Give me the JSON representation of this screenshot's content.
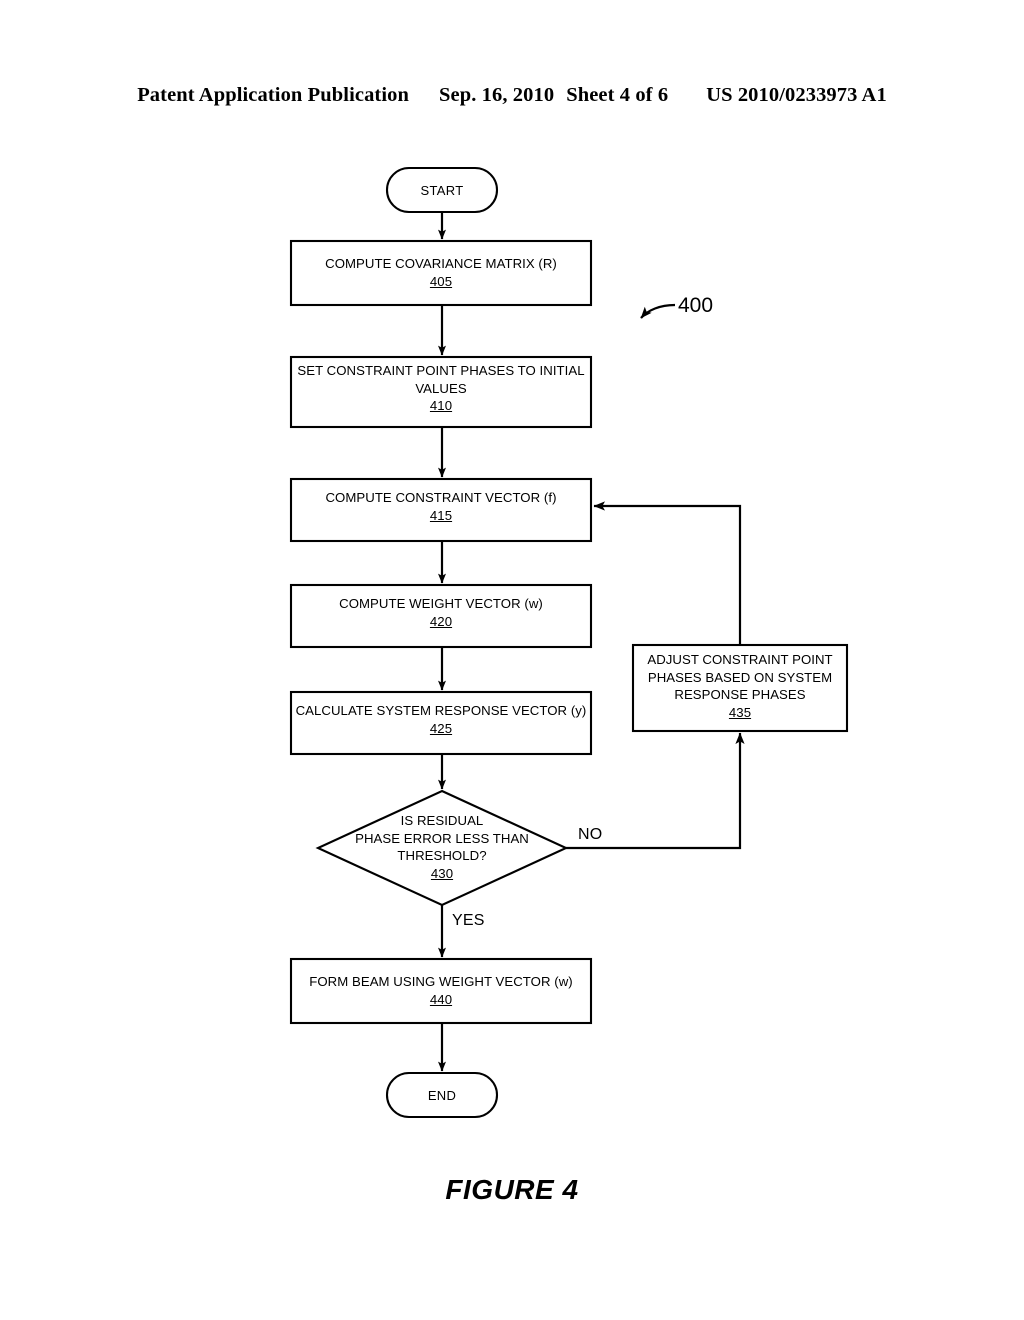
{
  "header": {
    "publication": "Patent Application Publication",
    "date": "Sep. 16, 2010",
    "sheet": "Sheet 4 of 6",
    "patent_number": "US 2010/0233973 A1"
  },
  "caption": "FIGURE 4",
  "diagram": {
    "reference_numeral": "400",
    "stroke_color": "#000000",
    "fill_color": "#ffffff",
    "nodes": {
      "start": {
        "label": "START",
        "shape": "terminal"
      },
      "step_405": {
        "line1": "COMPUTE COVARIANCE MATRIX (R)",
        "ref": "405",
        "shape": "process"
      },
      "step_410": {
        "line1": "SET CONSTRAINT POINT PHASES TO INITIAL",
        "line2": "VALUES",
        "ref": "410",
        "shape": "process"
      },
      "step_415": {
        "line1": "COMPUTE CONSTRAINT VECTOR (f)",
        "ref": "415",
        "shape": "process"
      },
      "step_420": {
        "line1": "COMPUTE WEIGHT VECTOR (w)",
        "ref": "420",
        "shape": "process"
      },
      "step_425": {
        "line1": "CALCULATE SYSTEM RESPONSE VECTOR (y)",
        "ref": "425",
        "shape": "process"
      },
      "decision_430": {
        "line1": "IS RESIDUAL",
        "line2": "PHASE ERROR LESS THAN",
        "line3": "THRESHOLD?",
        "ref": "430",
        "shape": "decision"
      },
      "step_435": {
        "line1": "ADJUST CONSTRAINT POINT",
        "line2": "PHASES BASED ON SYSTEM",
        "line3": "RESPONSE PHASES",
        "ref": "435",
        "shape": "process"
      },
      "step_440": {
        "line1": "FORM BEAM USING WEIGHT VECTOR (w)",
        "ref": "440",
        "shape": "process"
      },
      "end": {
        "label": "END",
        "shape": "terminal"
      }
    },
    "branches": {
      "no_label": "NO",
      "yes_label": "YES"
    }
  }
}
